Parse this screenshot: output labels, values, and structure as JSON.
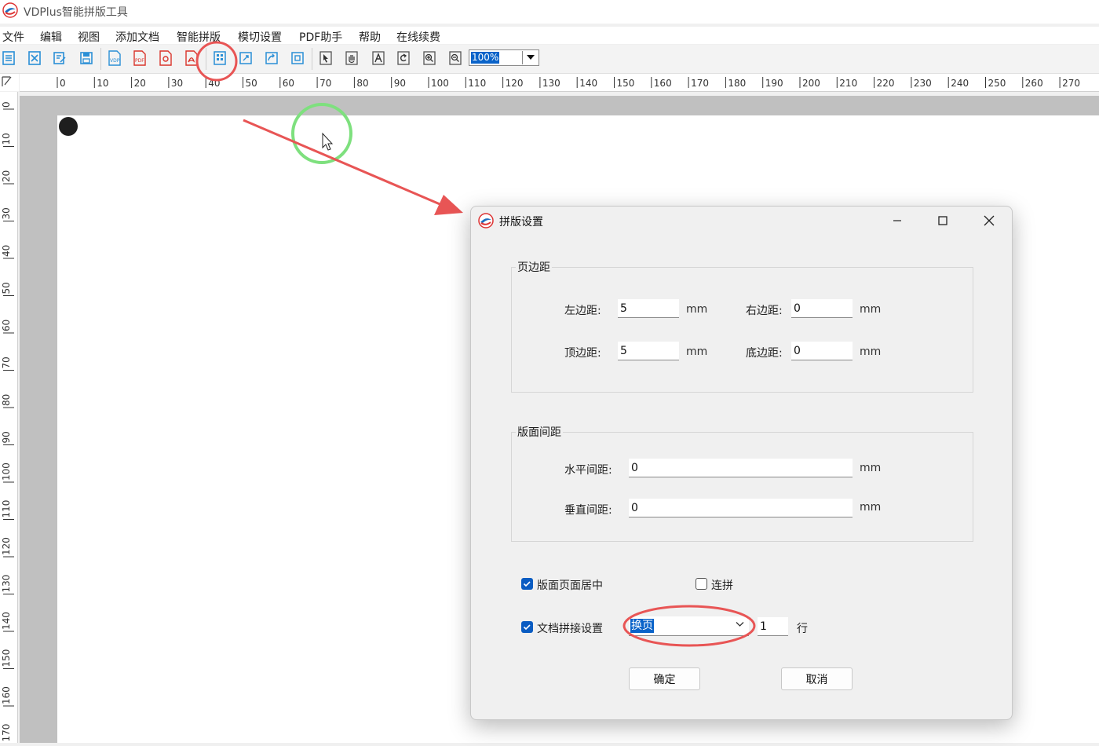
{
  "app": {
    "title": "VDPlus智能拼版工具"
  },
  "menu": [
    "文件",
    "编辑",
    "视图",
    "添加文档",
    "智能拼版",
    "模切设置",
    "PDF助手",
    "帮助",
    "在线续费"
  ],
  "toolbar": {
    "zoom_value": "100%",
    "buttons": [
      "new-doc-icon",
      "close-doc-icon",
      "edit-doc-icon",
      "save-icon",
      "export-vdp-icon",
      "export-pdf-icon",
      "pdf-search-icon",
      "pdf-acrobat-icon",
      "layout-settings-icon",
      "edit-layout-icon",
      "rotate-layout-icon",
      "fit-layout-icon",
      "select-pointer-icon",
      "hand-pan-icon",
      "text-tool-icon",
      "rotate-icon",
      "zoom-in-icon",
      "zoom-out-icon"
    ]
  },
  "ruler": {
    "h_labels": [
      "0",
      "10",
      "20",
      "30",
      "40",
      "50",
      "60",
      "70",
      "80",
      "90",
      "100",
      "110",
      "120",
      "130",
      "140",
      "150",
      "160",
      "170",
      "180",
      "190",
      "200",
      "210",
      "220",
      "230",
      "240",
      "250",
      "260",
      "270"
    ],
    "v_labels": [
      "0",
      "10",
      "20",
      "30",
      "40",
      "50",
      "60",
      "70",
      "80",
      "90",
      "100",
      "110",
      "120",
      "130",
      "140",
      "150",
      "160",
      "170"
    ]
  },
  "dialog": {
    "title": "拼版设置",
    "margins": {
      "group_label": "页边距",
      "left_label": "左边距:",
      "left_value": "5",
      "right_label": "右边距:",
      "right_value": "0",
      "top_label": "顶边距:",
      "top_value": "5",
      "bottom_label": "底边距:",
      "bottom_value": "0",
      "unit": "mm"
    },
    "spacing": {
      "group_label": "版面间距",
      "h_label": "水平间距:",
      "h_value": "0",
      "v_label": "垂直间距:",
      "v_value": "0",
      "unit": "mm"
    },
    "center_label": "版面页面居中",
    "center_checked": true,
    "continuous_label": "连拼",
    "continuous_checked": false,
    "join_label": "文档拼接设置",
    "join_checked": true,
    "join_mode": "换页",
    "rows_value": "1",
    "rows_unit": "行",
    "ok_label": "确定",
    "cancel_label": "取消"
  },
  "colors": {
    "accent": "#0a5cc2",
    "annotation_red": "#e85555",
    "annotation_green": "#7ee07e"
  }
}
